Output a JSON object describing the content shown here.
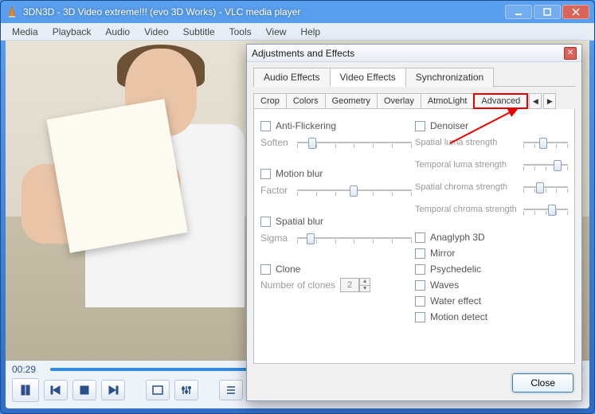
{
  "window": {
    "title": "3DN3D - 3D Video extreme!!! (evo 3D Works) - VLC media player"
  },
  "menu": [
    "Media",
    "Playback",
    "Audio",
    "Video",
    "Subtitle",
    "Tools",
    "View",
    "Help"
  ],
  "player": {
    "time": "00:29"
  },
  "dialog": {
    "title": "Adjustments and Effects",
    "tabs": [
      "Audio Effects",
      "Video Effects",
      "Synchronization"
    ],
    "active_tab": 1,
    "subtabs": [
      "Crop",
      "Colors",
      "Geometry",
      "Overlay",
      "AtmoLight",
      "Advanced"
    ],
    "active_subtab": 5,
    "left": {
      "anti_flicker": {
        "label": "Anti-Flickering",
        "slider": "Soften"
      },
      "motion_blur": {
        "label": "Motion blur",
        "slider": "Factor"
      },
      "spatial_blur": {
        "label": "Spatial blur",
        "slider": "Sigma"
      },
      "clone": {
        "label": "Clone",
        "num_label": "Number of clones",
        "num_value": "2"
      }
    },
    "right": {
      "denoiser": {
        "label": "Denoiser",
        "slider1": "Spatial luma strength",
        "slider2": "Temporal luma strength",
        "slider3": "Spatial chroma strength",
        "slider4": "Temporal chroma strength"
      },
      "checks": [
        "Anaglyph 3D",
        "Mirror",
        "Psychedelic",
        "Waves",
        "Water effect",
        "Motion detect"
      ]
    },
    "close_btn": "Close"
  }
}
